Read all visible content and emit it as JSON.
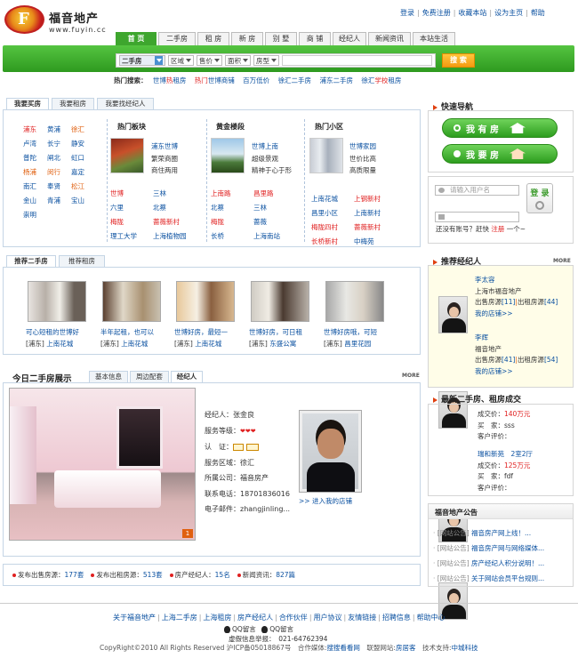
{
  "header": {
    "logo_letter": "F",
    "site_name": "福音地产",
    "site_url": "www.fuyin.cc",
    "top_links": [
      "登录",
      "免费注册",
      "收藏本站",
      "设为主页",
      "帮助"
    ]
  },
  "nav": {
    "tabs": [
      "首 页",
      "二手房",
      "租 房",
      "新 房",
      "别 墅",
      "商 铺",
      "经纪人",
      "新闻资讯",
      "本站生活"
    ]
  },
  "search": {
    "type": "二手房",
    "filters": [
      "区域",
      "售价",
      "面积",
      "房型"
    ],
    "button": "搜 索"
  },
  "hot_search": {
    "label": "热门搜索：",
    "items": [
      {
        "pre": "世博",
        "hl": "热",
        "post": "租房"
      },
      {
        "pre": "",
        "hl": "热门",
        "post": "世博商铺"
      },
      {
        "pre": "百万低价",
        "hl": "",
        "post": ""
      },
      {
        "pre": "徐汇二手房",
        "hl": "",
        "post": ""
      },
      {
        "pre": "浦东二手房",
        "hl": "",
        "post": ""
      },
      {
        "pre": "徐汇",
        "hl": "学校",
        "post": "租房"
      }
    ]
  },
  "panel_tabs": [
    "我要买房",
    "我要租房",
    "我要找经纪人"
  ],
  "areas": [
    "浦东",
    "黄浦",
    "徐汇",
    "卢湾",
    "长宁",
    "静安",
    "普陀",
    "闸北",
    "虹口",
    "杨浦",
    "闵行",
    "嘉定",
    "南汇",
    "奉贤",
    "松江",
    "金山",
    "青浦",
    "宝山",
    "崇明"
  ],
  "columns": [
    {
      "title": "热门板块",
      "img_link": "浦东世博",
      "features": [
        "繁荣商圈",
        "商住两用"
      ],
      "links": [
        "世博",
        "三林",
        "六里",
        "北蔡",
        "梅陇",
        "蔷薇新村",
        "理工大学",
        "上海植物园"
      ]
    },
    {
      "title": "黄金楼段",
      "img_link": "世博上南",
      "features": [
        "超级景观",
        "精神于心于形"
      ],
      "links": [
        "上南路",
        "昌里路",
        "北蔡",
        "三林",
        "梅陇",
        "蔷薇",
        "长桥",
        "上海南站"
      ]
    },
    {
      "title": "热门小区",
      "img_link": "世博家园",
      "features": [
        "世价比高",
        "高质限量"
      ],
      "links": [
        "上南花城",
        "上钢新村",
        "昌里小区",
        "上南新村",
        "梅陇四村",
        "蔷薇新村",
        "长桥新村",
        "中梅苑"
      ]
    }
  ],
  "rec_tabs": [
    "推荐二手房",
    "推荐租房"
  ],
  "recommended": [
    {
      "title": "可心短租的世博好",
      "area": "[浦东]",
      "estate": "上南花城"
    },
    {
      "title": "半年起租，也可以",
      "area": "[浦东]",
      "estate": "上南花城"
    },
    {
      "title": "世博好房，最短一",
      "area": "[浦东]",
      "estate": "上南花城"
    },
    {
      "title": "世博好房，可日租",
      "area": "[浦东]",
      "estate": "东盛公寓"
    },
    {
      "title": "世博好房哦，可短",
      "area": "[浦东]",
      "estate": "昌里花园"
    }
  ],
  "today": {
    "title": "今日二手房展示",
    "tabs": [
      "基本信息",
      "周边配套",
      "经纪人"
    ],
    "more": "MORE",
    "img_badge": "1",
    "agent": {
      "name_label": "经纪人：",
      "name": "张金良",
      "level_label": "服务等级：",
      "level_hearts": "❤❤❤",
      "cert_label": "认　证：",
      "region_label": "服务区域：",
      "region": "徐汇",
      "company_label": "所属公司：",
      "company": "福音房产",
      "phone_label": "联系电话：",
      "phone": "18701836016",
      "email_label": "电子邮件：",
      "email": "zhangjinling...",
      "shop_link": ">> 进入我的店铺"
    }
  },
  "stats": [
    {
      "label": "发布出售房源：",
      "value": "177套"
    },
    {
      "label": "发布出租房源：",
      "value": "513套"
    },
    {
      "label": "房产经纪人：",
      "value": "15名"
    },
    {
      "label": "新闻资讯：",
      "value": "827篇"
    }
  ],
  "right": {
    "quick_nav": "快速导航",
    "btn_find": "我 有 房",
    "btn_buy": "我 要 房",
    "username_ph": "请输入用户名",
    "login_btn": "登 录",
    "register_text": "还没有账号？赶快",
    "register_link": "注册",
    "register_tail": "一个~",
    "agents_title": "推荐经纪人",
    "more": "MORE",
    "agents": [
      {
        "name": "李太容",
        "company": "上海市福音地产",
        "sale_label": "出售房源",
        "sale": "[11]",
        "rent_label": "出租房源",
        "rent": "[44]",
        "shop": "我的店铺>>"
      },
      {
        "name": "李辉",
        "company": "福音地产",
        "sale_label": "出售房源",
        "sale": "[41]",
        "rent_label": "出租房源",
        "rent": "[54]",
        "shop": "我的店铺>>"
      }
    ],
    "deals_title": "最新二手房、租房成交",
    "deals": [
      {
        "price_label": "成交价：",
        "price": "140万元",
        "buyer_label": "买　家：",
        "buyer": "sss",
        "eval_label": "客户评价："
      },
      {
        "title": "瑞和新苑　2室2厅",
        "price_label": "成交价：",
        "price": "125万元",
        "buyer_label": "买　家：",
        "buyer": "fdf",
        "eval_label": "客户评价："
      }
    ],
    "notice_title": "福音地产公告",
    "notices": [
      {
        "tag": "[网站公告]",
        "text": "福音房产网上线！..."
      },
      {
        "tag": "[网站公告]",
        "text": "福音房产网与网络媒体..."
      },
      {
        "tag": "[网站公告]",
        "text": "房产经纪人积分说明！..."
      },
      {
        "tag": "[网站公告]",
        "text": "关于网站会员平台规则..."
      }
    ]
  },
  "footer": {
    "links": [
      "关于福音地产",
      "上海二手房",
      "上海租房",
      "房产经纪人",
      "合作伙伴",
      "用户协议",
      "友情链接",
      "招聘信息",
      "帮助中心"
    ],
    "qq": [
      "QQ留言",
      "QQ留言"
    ],
    "report": "虚假信息举报：　021-64762394",
    "copyright": "CopyRight©2010 All Rights Reserved 沪ICP备05018867号　合作媒体:",
    "media": "搜搜看看网",
    "partner_label": "　联盟网站:",
    "partner": "房居客",
    "tech_label": "　技术支持:",
    "tech": "中城科技"
  }
}
